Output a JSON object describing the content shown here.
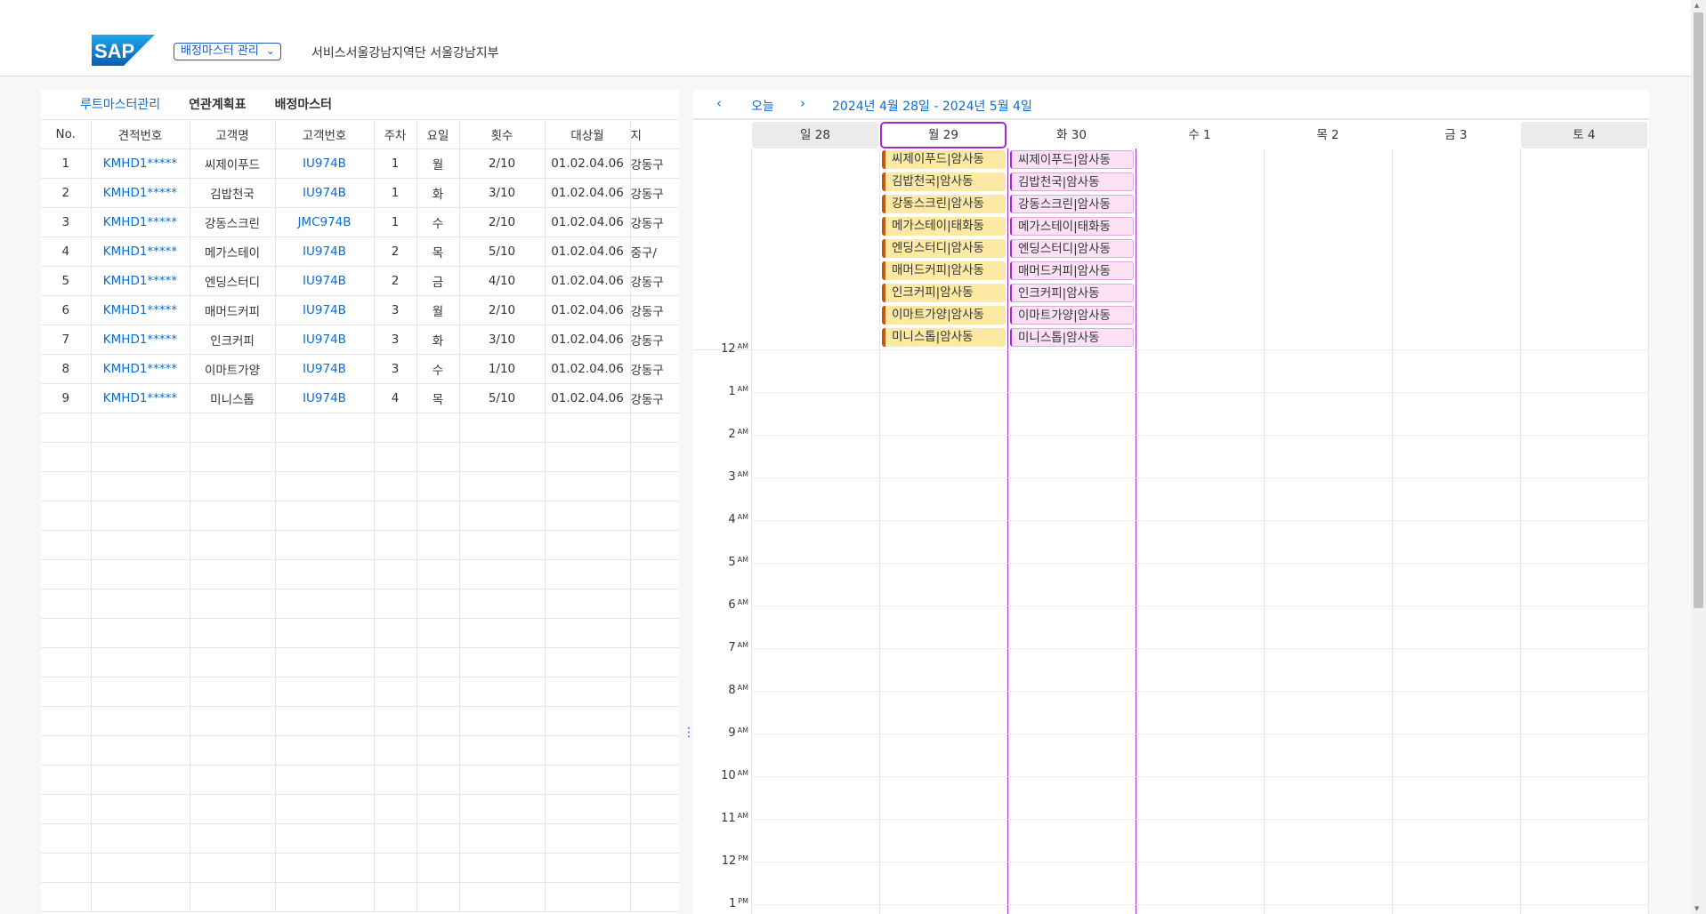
{
  "header": {
    "logo": "SAP",
    "menu_label": "배정마스터 관리",
    "org_path": "서비스서울강남지역단 서울강남지부"
  },
  "tabs": [
    "루트마스터관리",
    "연관계획표",
    "배정마스터"
  ],
  "table": {
    "columns": [
      "No.",
      "견적번호",
      "고객명",
      "고객번호",
      "주차",
      "요일",
      "횟수",
      "대상월",
      "지"
    ],
    "rows": [
      [
        "1",
        "KMHD1*****",
        "씨제이푸드",
        "IU974B",
        "1",
        "월",
        "2/10",
        "01.02.04.06",
        "강동구"
      ],
      [
        "2",
        "KMHD1*****",
        "김밥천국",
        "IU974B",
        "1",
        "화",
        "3/10",
        "01.02.04.06",
        "강동구"
      ],
      [
        "3",
        "KMHD1*****",
        "강동스크린",
        "JMC974B",
        "1",
        "수",
        "2/10",
        "01.02.04.06",
        "강동구"
      ],
      [
        "4",
        "KMHD1*****",
        "메가스테이",
        "IU974B",
        "2",
        "목",
        "5/10",
        "01.02.04.06",
        "중구/"
      ],
      [
        "5",
        "KMHD1*****",
        "엔딩스터디",
        "IU974B",
        "2",
        "금",
        "4/10",
        "01.02.04.06",
        "강동구"
      ],
      [
        "6",
        "KMHD1*****",
        "매머드커피",
        "IU974B",
        "3",
        "월",
        "2/10",
        "01.02.04.06",
        "강동구"
      ],
      [
        "7",
        "KMHD1*****",
        "인크커피",
        "IU974B",
        "3",
        "화",
        "3/10",
        "01.02.04.06",
        "강동구"
      ],
      [
        "8",
        "KMHD1*****",
        "이마트가양",
        "IU974B",
        "3",
        "수",
        "1/10",
        "01.02.04.06",
        "강동구"
      ],
      [
        "9",
        "KMHD1*****",
        "미니스톱",
        "IU974B",
        "4",
        "목",
        "5/10",
        "01.02.04.06",
        "강동구"
      ]
    ],
    "empty_rows": 17
  },
  "calendar": {
    "prev_icon": "‹",
    "next_icon": "›",
    "today_label": "오늘",
    "range_label": "2024년 4월 28일 - 2024년 5월 4일",
    "days": [
      {
        "label": "일 28",
        "weekend": true
      },
      {
        "label": "월 29",
        "selected": true
      },
      {
        "label": "화 30"
      },
      {
        "label": "수 1"
      },
      {
        "label": "목 2"
      },
      {
        "label": "금 3"
      },
      {
        "label": "토 4",
        "weekend": true
      }
    ],
    "hours": [
      {
        "n": "12",
        "p": "AM"
      },
      {
        "n": "1",
        "p": "AM"
      },
      {
        "n": "2",
        "p": "AM"
      },
      {
        "n": "3",
        "p": "AM"
      },
      {
        "n": "4",
        "p": "AM"
      },
      {
        "n": "5",
        "p": "AM"
      },
      {
        "n": "6",
        "p": "AM"
      },
      {
        "n": "7",
        "p": "AM"
      },
      {
        "n": "8",
        "p": "AM"
      },
      {
        "n": "9",
        "p": "AM"
      },
      {
        "n": "10",
        "p": "AM"
      },
      {
        "n": "11",
        "p": "AM"
      },
      {
        "n": "12",
        "p": "PM"
      },
      {
        "n": "1",
        "p": "PM"
      }
    ],
    "events_mon": [
      "씨제이푸드|암사동",
      "김밥천국|암사동",
      "강동스크린|암사동",
      "메가스테이|태화동",
      "엔딩스터디|암사동",
      "매머드커피|암사동",
      "인크커피|암사동",
      "이마트가양|암사동",
      "미니스톱|암사동"
    ],
    "events_tue": [
      "씨제이푸드|암사동",
      "김밥천국|암사동",
      "강동스크린|암사동",
      "메가스테이|태화동",
      "엔딩스터디|암사동",
      "매머드커피|암사동",
      "인크커피|암사동",
      "이마트가양|암사동",
      "미니스톱|암사동"
    ]
  },
  "colors": {
    "accent": "#0a6ed1",
    "selected_day": "#a32ad3",
    "event_yellow": "#fce9a4",
    "event_pink": "#fbe0f6"
  }
}
